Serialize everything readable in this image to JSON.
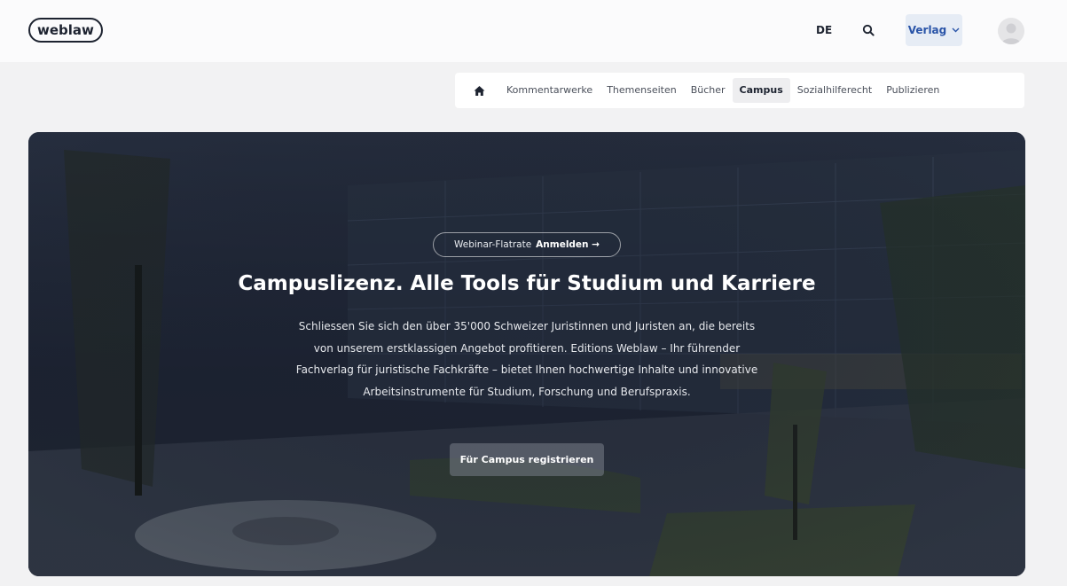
{
  "header": {
    "logo": "weblaw",
    "language": "DE",
    "search_icon": "search-icon",
    "verlag_label": "Verlag",
    "verlag_icon": "chevron-down-icon",
    "avatar_icon": "user-avatar-icon"
  },
  "nav": {
    "home_icon": "home-icon",
    "items": [
      {
        "label": "Kommentarwerke"
      },
      {
        "label": "Themenseiten"
      },
      {
        "label": "Bücher"
      },
      {
        "label": "Campus"
      },
      {
        "label": "Sozialhilferecht"
      },
      {
        "label": "Publizieren"
      }
    ],
    "active": "Campus"
  },
  "hero": {
    "pill_text": "Webinar-Flatrate",
    "pill_link": "Anmelden →",
    "title": "Campuslizenz. Alle Tools für Studium und Karriere",
    "description": "Schliessen Sie sich den über 35'000 Schweizer Juristinnen und Juristen an, die bereits von unserem erstklassigen Angebot profitieren. Editions Weblaw – Ihr führender Fachverlag für juristische Fachkräfte – bietet Ihnen hochwertige Inhalte und innovative Arbeitsinstrumente für Studium, Forschung und Berufspraxis.",
    "cta_label": "Für Campus registrieren"
  },
  "colors": {
    "accent": "#2a54a8",
    "hero_overlay": "#1f2635",
    "page_bg": "#f2f2f3"
  }
}
